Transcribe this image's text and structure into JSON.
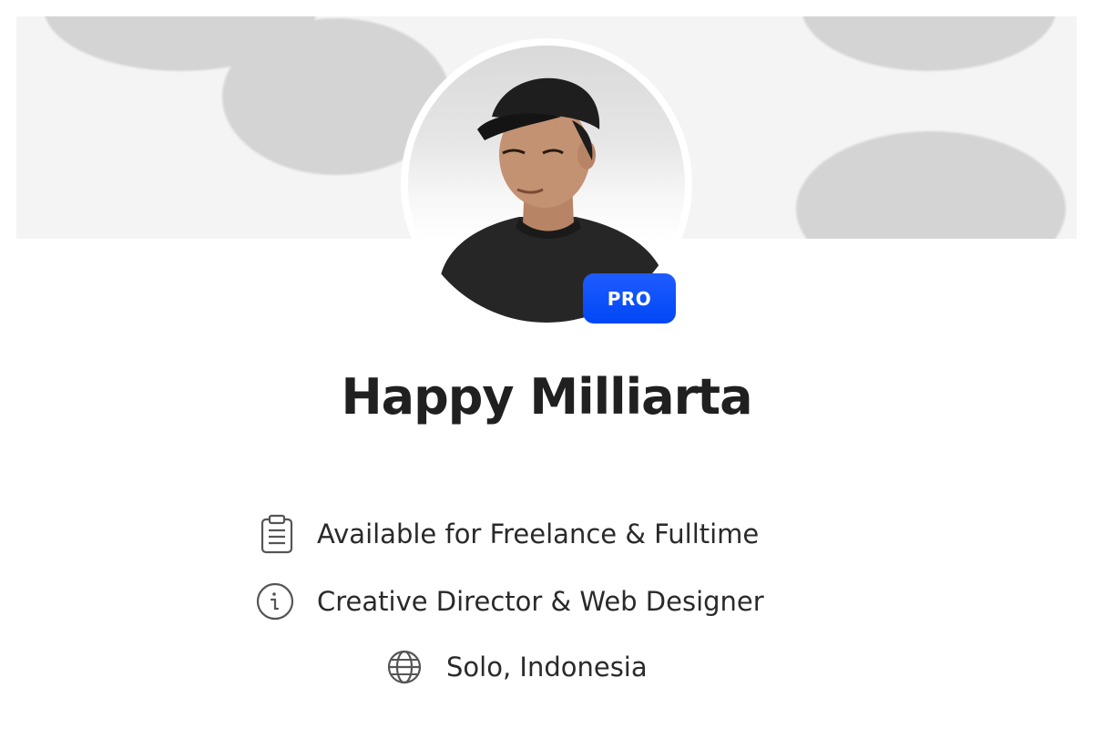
{
  "profile": {
    "name": "Happy Milliarta",
    "badge": "PRO",
    "details": [
      {
        "icon": "clipboard-icon",
        "text": "Available for Freelance & Fulltime"
      },
      {
        "icon": "info-icon",
        "text": "Creative Director & Web Designer"
      },
      {
        "icon": "globe-icon",
        "text": "Solo, Indonesia"
      }
    ]
  },
  "colors": {
    "badge": "#0047f5",
    "cover": "#f4f4f4",
    "cover_blobs": "#d4d4d4",
    "text": "#202020"
  }
}
